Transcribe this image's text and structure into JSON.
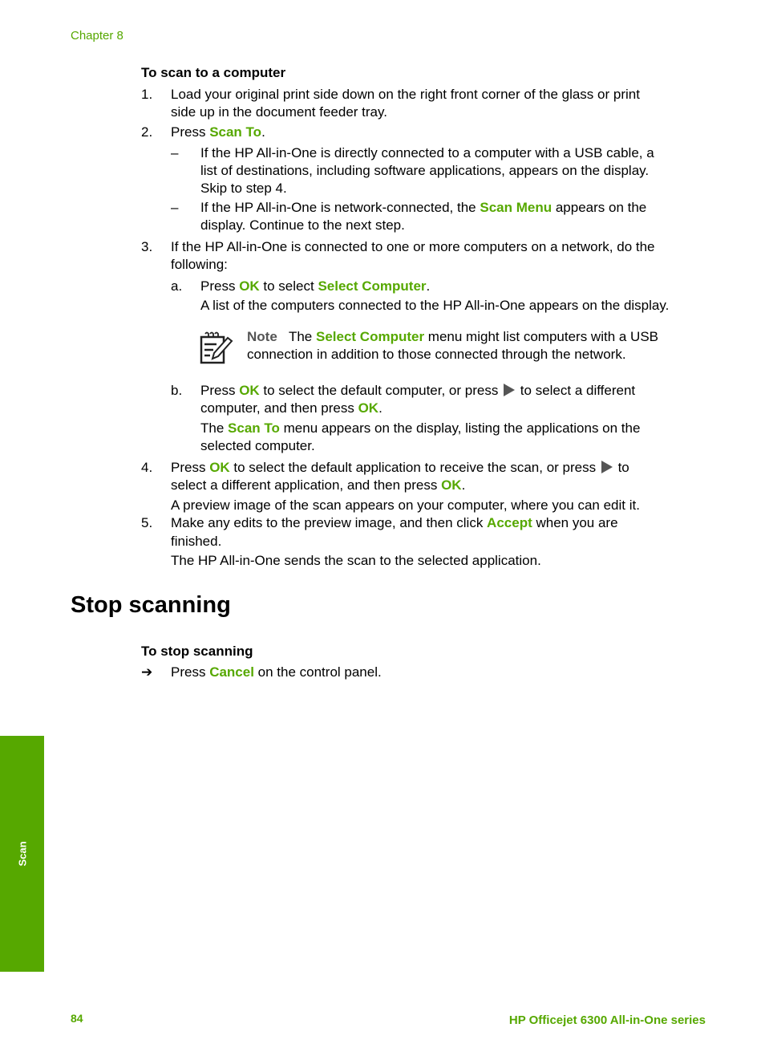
{
  "header": {
    "chapter": "Chapter 8"
  },
  "procedure1": {
    "title": "To scan to a computer",
    "step1": {
      "num": "1.",
      "l1": "Load your original print side down on the right front corner of the glass or print",
      "l2": "side up in the document feeder tray."
    },
    "step2": {
      "num": "2.",
      "pre": "Press ",
      "key": "Scan To",
      "post": "."
    },
    "dash1": {
      "mark": "–",
      "l1": "If the HP All-in-One is directly connected to a computer with a USB cable, a",
      "l2": "list of destinations, including software applications, appears on the display.",
      "l3": "Skip to step 4."
    },
    "dash2": {
      "mark": "–",
      "l1pre": "If the HP All-in-One is network-connected, the ",
      "l1key": "Scan Menu",
      "l1post": " appears on the",
      "l2": "display. Continue to the next step."
    },
    "step3": {
      "num": "3.",
      "l1": "If the HP All-in-One is connected to one or more computers on a network, do the",
      "l2": "following:"
    },
    "sub_a": {
      "mark": "a.",
      "pre": "Press ",
      "key1": "OK",
      "mid": " to select ",
      "key2": "Select Computer",
      "post": ".",
      "l2": "A list of the computers connected to the HP All-in-One appears on the display."
    },
    "note": {
      "label": "Note",
      "pre": "The ",
      "key": "Select Computer",
      "post": " menu might list computers with a USB",
      "l2": "connection in addition to those connected through the network."
    },
    "sub_b": {
      "mark": "b.",
      "pre": "Press ",
      "key1": "OK",
      "mid": " to select the default computer, or press ",
      "post": " to select a different",
      "l2pre": "computer, and then press ",
      "l2key": "OK",
      "l2post": ".",
      "l3pre": "The ",
      "l3key": "Scan To",
      "l3post": " menu appears on the display, listing the applications on the",
      "l4": "selected computer."
    },
    "step4": {
      "num": "4.",
      "pre": "Press ",
      "key1": "OK",
      "mid": " to select the default application to receive the scan, or press ",
      "post": " to",
      "l2pre": "select a different application, and then press ",
      "l2key": "OK",
      "l2post": ".",
      "l3": "A preview image of the scan appears on your computer, where you can edit it."
    },
    "step5": {
      "num": "5.",
      "pre": "Make any edits to the preview image, and then click ",
      "key": "Accept",
      "post": " when you are",
      "l2": "finished.",
      "l3": "The HP All-in-One sends the scan to the selected application."
    }
  },
  "section": {
    "title": "Stop scanning",
    "proc_title": "To stop scanning",
    "arrow": "➔",
    "pre": "Press ",
    "key": "Cancel",
    "post": " on the control panel."
  },
  "sidebar": {
    "label": "Scan"
  },
  "footer": {
    "page": "84",
    "title": "HP Officejet 6300 All-in-One series"
  },
  "colors": {
    "accent": "#56a800"
  }
}
